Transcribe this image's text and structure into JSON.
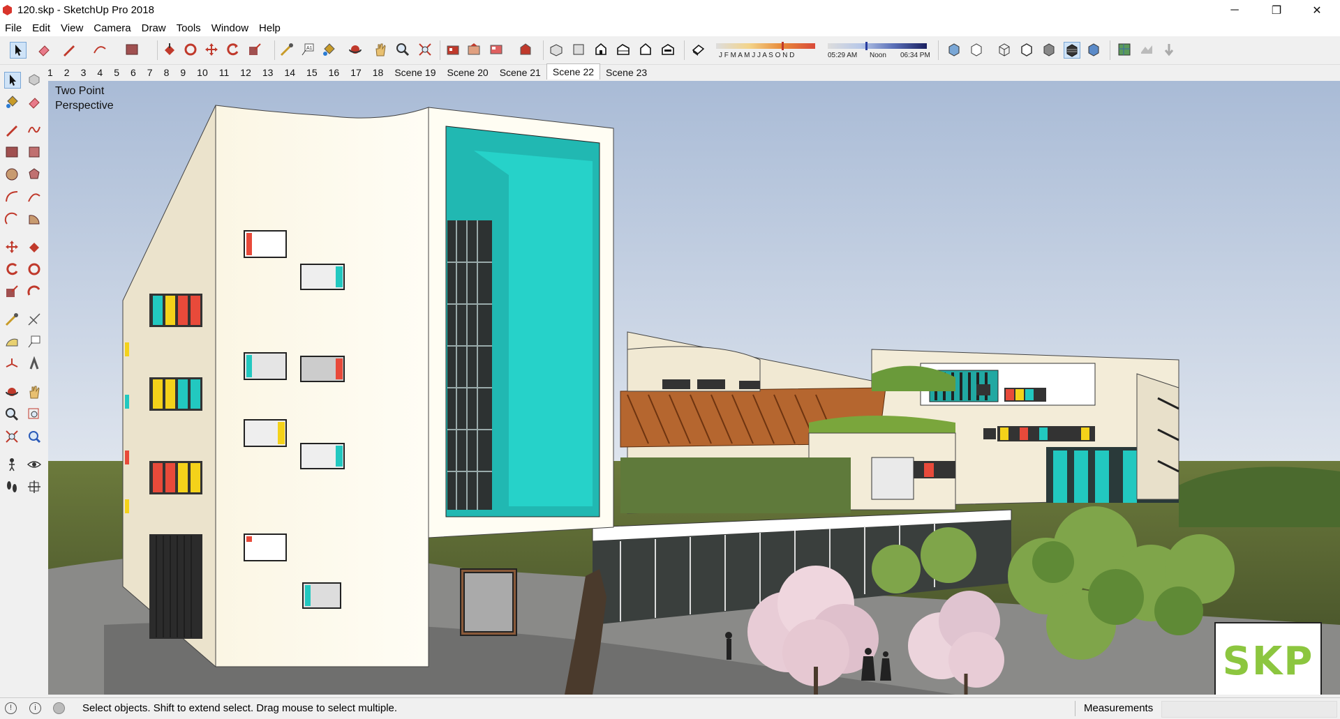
{
  "window": {
    "title": "120.skp - SketchUp Pro 2018",
    "minimize": "─",
    "restore": "❐",
    "close": "✕"
  },
  "menu": [
    "File",
    "Edit",
    "View",
    "Camera",
    "Draw",
    "Tools",
    "Window",
    "Help"
  ],
  "shadow_widget": {
    "months": "J F M A M J J A S O N D",
    "time_start": "05:29 AM",
    "time_mid": "Noon",
    "time_end": "06:34 PM"
  },
  "scene_tabs": [
    "1",
    "2",
    "3",
    "4",
    "5",
    "6",
    "7",
    "8",
    "9",
    "10",
    "11",
    "12",
    "13",
    "14",
    "15",
    "16",
    "17",
    "18",
    "Scene 19",
    "Scene 20",
    "Scene 21",
    "Scene 22",
    "Scene 23"
  ],
  "active_scene": "Scene 22",
  "viewport": {
    "camera_line1": "Two Point",
    "camera_line2": "Perspective",
    "watermark": "SKP"
  },
  "status": {
    "message": "Select objects. Shift to extend select. Drag mouse to select multiple.",
    "measurements_label": "Measurements",
    "measurements_value": ""
  },
  "colors": {
    "accent_teal": "#22c8c0",
    "sky": "#b4c3da",
    "building": "#f5efdc",
    "logo_green": "#8cc63f"
  }
}
